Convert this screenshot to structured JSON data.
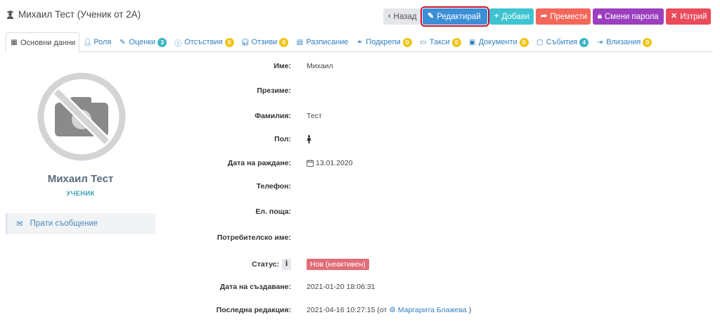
{
  "page": {
    "title": "Михаил Тест (Ученик от 2А)"
  },
  "actions": {
    "back": "Назад",
    "edit": "Редактирай",
    "add": "Добави",
    "move": "Премести",
    "change_password": "Смени парола",
    "delete": "Изтрий"
  },
  "tabs": [
    {
      "label": "Основни данни",
      "icon": "grid-icon",
      "badge": ""
    },
    {
      "label": "Роля",
      "icon": "user-plus-icon",
      "badge": ""
    },
    {
      "label": "Оценки",
      "icon": "pencil-icon",
      "badge": "3"
    },
    {
      "label": "Отсъствия",
      "icon": "info-circle-icon",
      "badge": "0"
    },
    {
      "label": "Отзиви",
      "icon": "headset-icon",
      "badge": "0"
    },
    {
      "label": "Разписание",
      "icon": "table-icon",
      "badge": ""
    },
    {
      "label": "Подкрепи",
      "icon": "handshake-icon",
      "badge": "0"
    },
    {
      "label": "Такси",
      "icon": "money-icon",
      "badge": "0"
    },
    {
      "label": "Документи",
      "icon": "id-card-icon",
      "badge": "0"
    },
    {
      "label": "Събития",
      "icon": "calendar-icon",
      "badge": "4"
    },
    {
      "label": "Влизания",
      "icon": "sign-in-icon",
      "badge": "0"
    }
  ],
  "profile": {
    "name": "Михаил Тест",
    "role": "УЧЕНИК",
    "send_message": "Прати съобщение"
  },
  "fields": {
    "first_name_label": "Име:",
    "first_name": "Михаил",
    "middle_name_label": "Презиме:",
    "middle_name": "",
    "last_name_label": "Фамилия:",
    "last_name": "Тест",
    "gender_label": "Пол:",
    "birth_date_label": "Дата на раждане:",
    "birth_date": "13.01.2020",
    "phone_label": "Телефон:",
    "phone": "",
    "email_label": "Ел. поща:",
    "email": "",
    "username_label": "Потребителско име:",
    "username": "",
    "status_label": "Статус:",
    "status": "Нов (неактивен)",
    "created_label": "Дата на създаване:",
    "created": "2021-01-20 18:06:31",
    "modified_label": "Последна редакция:",
    "modified": "2021-04-16 10:27:15",
    "modified_by_prefix": "(от",
    "modified_by": "Маргарита Блажева",
    "modified_by_suffix": ")"
  },
  "colors": {
    "edit": "#3c8ed6",
    "add": "#3ec4d1",
    "move": "#f2675a",
    "change_password": "#9b3fbf",
    "delete": "#ea4b5b",
    "status": "#e06d77",
    "link": "#2f7fc1",
    "highlight": "#c8102e"
  }
}
